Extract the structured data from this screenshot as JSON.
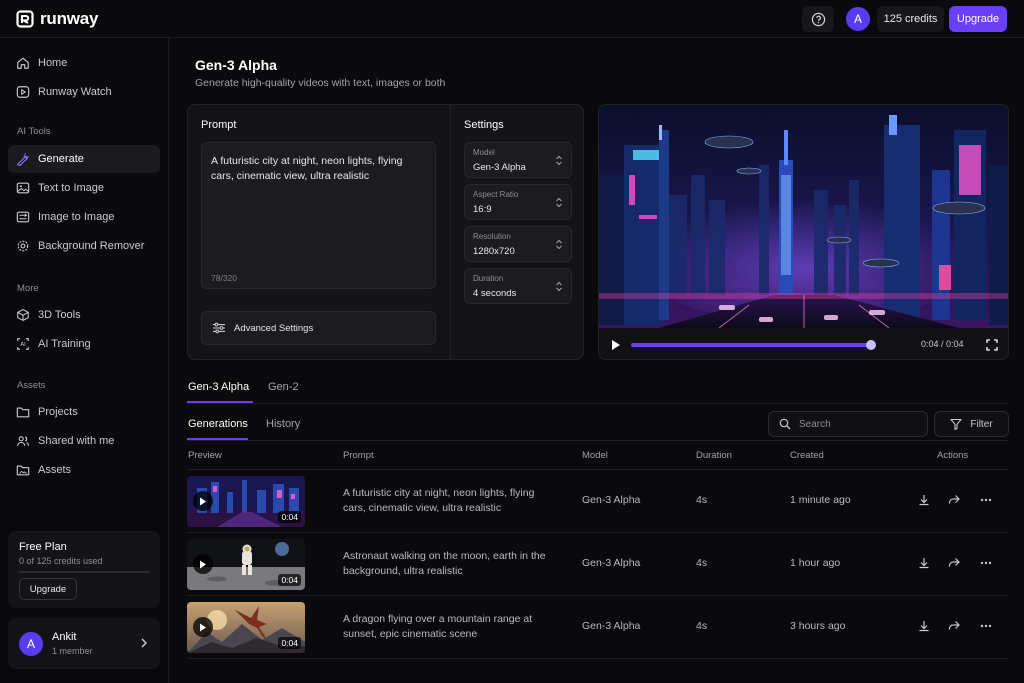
{
  "topbar": {
    "brand": "runway",
    "help_icon": "help-circle-icon",
    "avatar_initial": "A",
    "credits": "125 credits",
    "upgrade_label": "Upgrade"
  },
  "sidebar": {
    "items_top": [
      {
        "label": "Home",
        "icon": "home-icon"
      },
      {
        "label": "Runway Watch",
        "icon": "play-circle-icon"
      }
    ],
    "ai_tools_label": "AI Tools",
    "ai_tools": [
      {
        "label": "Generate",
        "icon": "magic-wand-icon",
        "active": true
      },
      {
        "label": "Text to Image",
        "icon": "image-icon"
      },
      {
        "label": "Image to Image",
        "icon": "image-convert-icon"
      },
      {
        "label": "Background Remover",
        "icon": "gear-icon"
      }
    ],
    "more_label": "More",
    "more": [
      {
        "label": "3D Tools",
        "icon": "cube-icon"
      },
      {
        "label": "AI Training",
        "icon": "ai-training-icon"
      }
    ],
    "assets_label": "Assets",
    "assets": [
      {
        "label": "Projects",
        "icon": "folder-icon"
      },
      {
        "label": "Shared with me",
        "icon": "users-icon"
      },
      {
        "label": "Assets",
        "icon": "folder-image-icon"
      }
    ],
    "plan": {
      "title": "Free Plan",
      "usage": "0 of 125 credits used",
      "usage_fraction": 0,
      "button": "Upgrade"
    },
    "user": {
      "initial": "A",
      "name": "Ankit",
      "subtitle": "1 member"
    }
  },
  "main": {
    "title": "Gen-3 Alpha",
    "subtitle": "Generate high-quality videos with text, images or both",
    "prompt": {
      "label": "Prompt",
      "value": "A futuristic city at night, neon lights, flying cars, cinematic view, ultra realistic",
      "count": "78/320",
      "advanced_label": "Advanced Settings"
    },
    "settings": {
      "label": "Settings",
      "fields": [
        {
          "label": "Model",
          "value": "Gen-3 Alpha"
        },
        {
          "label": "Aspect Ratio",
          "value": "16:9"
        },
        {
          "label": "Resolution",
          "value": "1280x720"
        },
        {
          "label": "Duration",
          "value": "4 seconds"
        }
      ]
    },
    "player": {
      "time": "0:04 / 0:04",
      "progress": 1.0
    },
    "model_tabs": [
      {
        "label": "Gen-3 Alpha",
        "active": true
      },
      {
        "label": "Gen-2",
        "active": false
      }
    ],
    "sub_tabs": [
      {
        "label": "Generations",
        "active": true
      },
      {
        "label": "History",
        "active": false
      }
    ],
    "search_placeholder": "Search",
    "filter_label": "Filter",
    "table": {
      "columns": [
        "Preview",
        "Prompt",
        "Model",
        "Duration",
        "Created",
        "Actions"
      ],
      "rows": [
        {
          "thumb": "city",
          "duration_badge": "0:04",
          "prompt": "A futuristic city at night, neon lights, flying cars, cinematic view, ultra realistic",
          "model": "Gen-3 Alpha",
          "duration": "4s",
          "created": "1 minute ago"
        },
        {
          "thumb": "moon",
          "duration_badge": "0:04",
          "prompt": "Astronaut walking on the moon, earth in the background, ultra realistic",
          "model": "Gen-3 Alpha",
          "duration": "4s",
          "created": "1 hour ago"
        },
        {
          "thumb": "dragon",
          "duration_badge": "0:04",
          "prompt": "A dragon flying over a mountain range at sunset, epic cinematic scene",
          "model": "Gen-3 Alpha",
          "duration": "4s",
          "created": "3 hours ago"
        }
      ]
    }
  },
  "colors": {
    "accent": "#6a3ff5",
    "background": "#0a0a0c",
    "panel": "#141418"
  }
}
